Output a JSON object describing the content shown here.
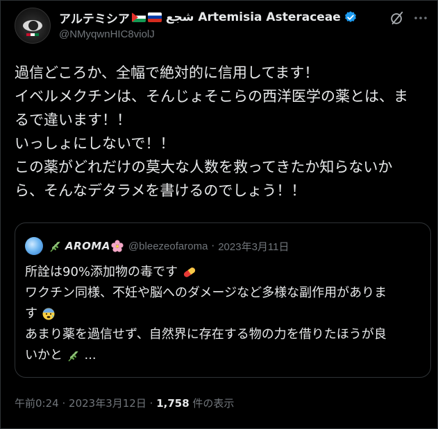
{
  "author": {
    "name_prefix": "アルテミシア",
    "name_suffix": "شجع Artemisia Asteraceae",
    "handle": "@NMyqwnHIC8violJ",
    "verified": true,
    "flag_icons": [
      "palestine-flag-icon",
      "russia-flag-icon"
    ]
  },
  "tweet": {
    "lines": [
      "過信どころか、全幅で絶対的に信用してます！",
      "イベルメクチンは、そんじょそこらの西洋医学の薬とは、ま",
      "るで違います！！",
      "いっしょにしないで！！",
      "この薬がどれだけの莫大な人数を救ってきたか知らないか",
      "ら、そんなデタラメを書けるのでしょう！！"
    ]
  },
  "quote": {
    "name": "AROMA",
    "handle": "@bleezeofaroma",
    "separator": "·",
    "date": "2023年3月11日",
    "line1": "所詮は90%添加物の毒です",
    "line2": "ワクチン同様、不妊や脳へのダメージなど多様な副作用がありま",
    "line3": "す",
    "line4": "あまり薬を過信せず、自然界に存在する物の力を借りたほうが良",
    "line5_prefix": "いかと",
    "line5_suffix": "..."
  },
  "footer": {
    "time": "午前0:24",
    "separator1": "·",
    "date": "2023年3月12日",
    "separator2": "·",
    "views_count": "1,758",
    "views_label": "件の表示"
  },
  "colors": {
    "background": "#000000",
    "text": "#e7e9ea",
    "muted": "#71767b",
    "border": "#2f3336",
    "verified": "#1d9bf0"
  },
  "icons": {
    "more": "more-icon",
    "grok": "grok-icon",
    "verified": "verified-badge-icon"
  }
}
